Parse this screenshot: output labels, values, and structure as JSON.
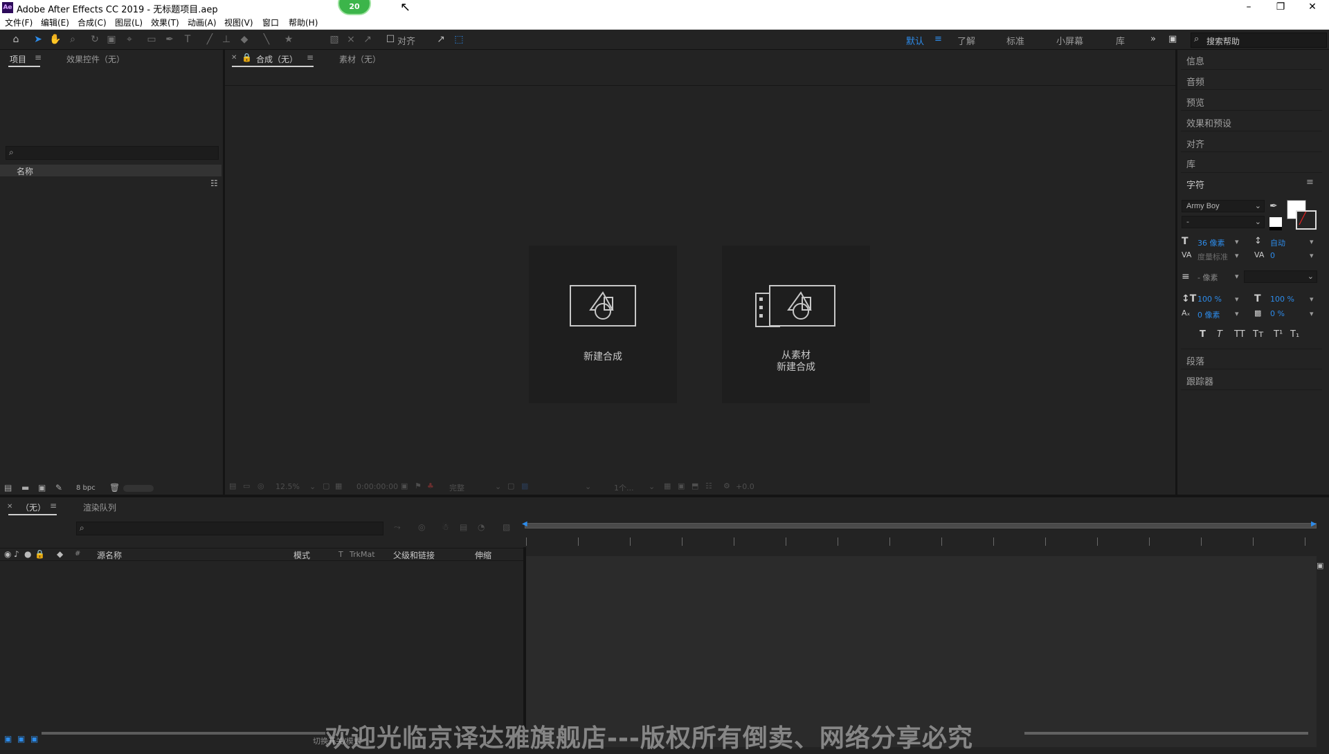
{
  "window": {
    "app_icon": "Ae",
    "title": "Adobe After Effects CC 2019 - 无标题项目.aep",
    "badge": "20"
  },
  "menu": [
    "文件(F)",
    "编辑(E)",
    "合成(C)",
    "图层(L)",
    "效果(T)",
    "动画(A)",
    "视图(V)",
    "窗口",
    "帮助(H)"
  ],
  "toolbar": {
    "align_label": "对齐",
    "workspaces": [
      "默认",
      "了解",
      "标准",
      "小屏幕",
      "库"
    ],
    "active_workspace": "默认",
    "search_placeholder": "搜索帮助"
  },
  "project_panel": {
    "tabs": [
      "项目",
      "效果控件（无）"
    ],
    "column_name": "名称",
    "bpc": "8 bpc"
  },
  "comp_panel": {
    "tabs": [
      "合成（无）",
      "素材（无）"
    ],
    "new_comp_label": "新建合成",
    "from_footage_line1": "从素材",
    "from_footage_line2": "新建合成",
    "zoom": "12.5%",
    "timecode": "0:00:00:00",
    "resolution": "完整",
    "view_count": "1个...",
    "exposure": "+0.0"
  },
  "timeline_panel": {
    "tabs": [
      "（无）",
      "渲染队列"
    ],
    "columns": [
      "源名称",
      "模式",
      "T",
      "TrkMat",
      "父级和链接",
      "伸缩"
    ],
    "toggle_label": "切换开关/模式"
  },
  "right_panel": {
    "sections_top": [
      "信息",
      "音频",
      "预览",
      "效果和预设",
      "对齐",
      "库"
    ],
    "character_title": "字符",
    "font_name": "Army Boy",
    "font_style": "-",
    "font_size": "36 像素",
    "leading": "自动",
    "kerning": "度量标准",
    "tracking": "0",
    "stroke_width": "- 像素",
    "vert_scale": "100 %",
    "horiz_scale": "100 %",
    "baseline": "0 像素",
    "tsume": "0 %",
    "style_buttons": [
      "T",
      "T",
      "TT",
      "Tт",
      "T¹",
      "T₁"
    ],
    "sections_bottom": [
      "段落",
      "跟踪器"
    ]
  },
  "watermark": "欢迎光临京译达雅旗舰店---版权所有倒卖、网络分享必究",
  "colors": {
    "accent": "#2d8ceb",
    "panel_bg": "#232323",
    "badge": "#3cb54a"
  }
}
